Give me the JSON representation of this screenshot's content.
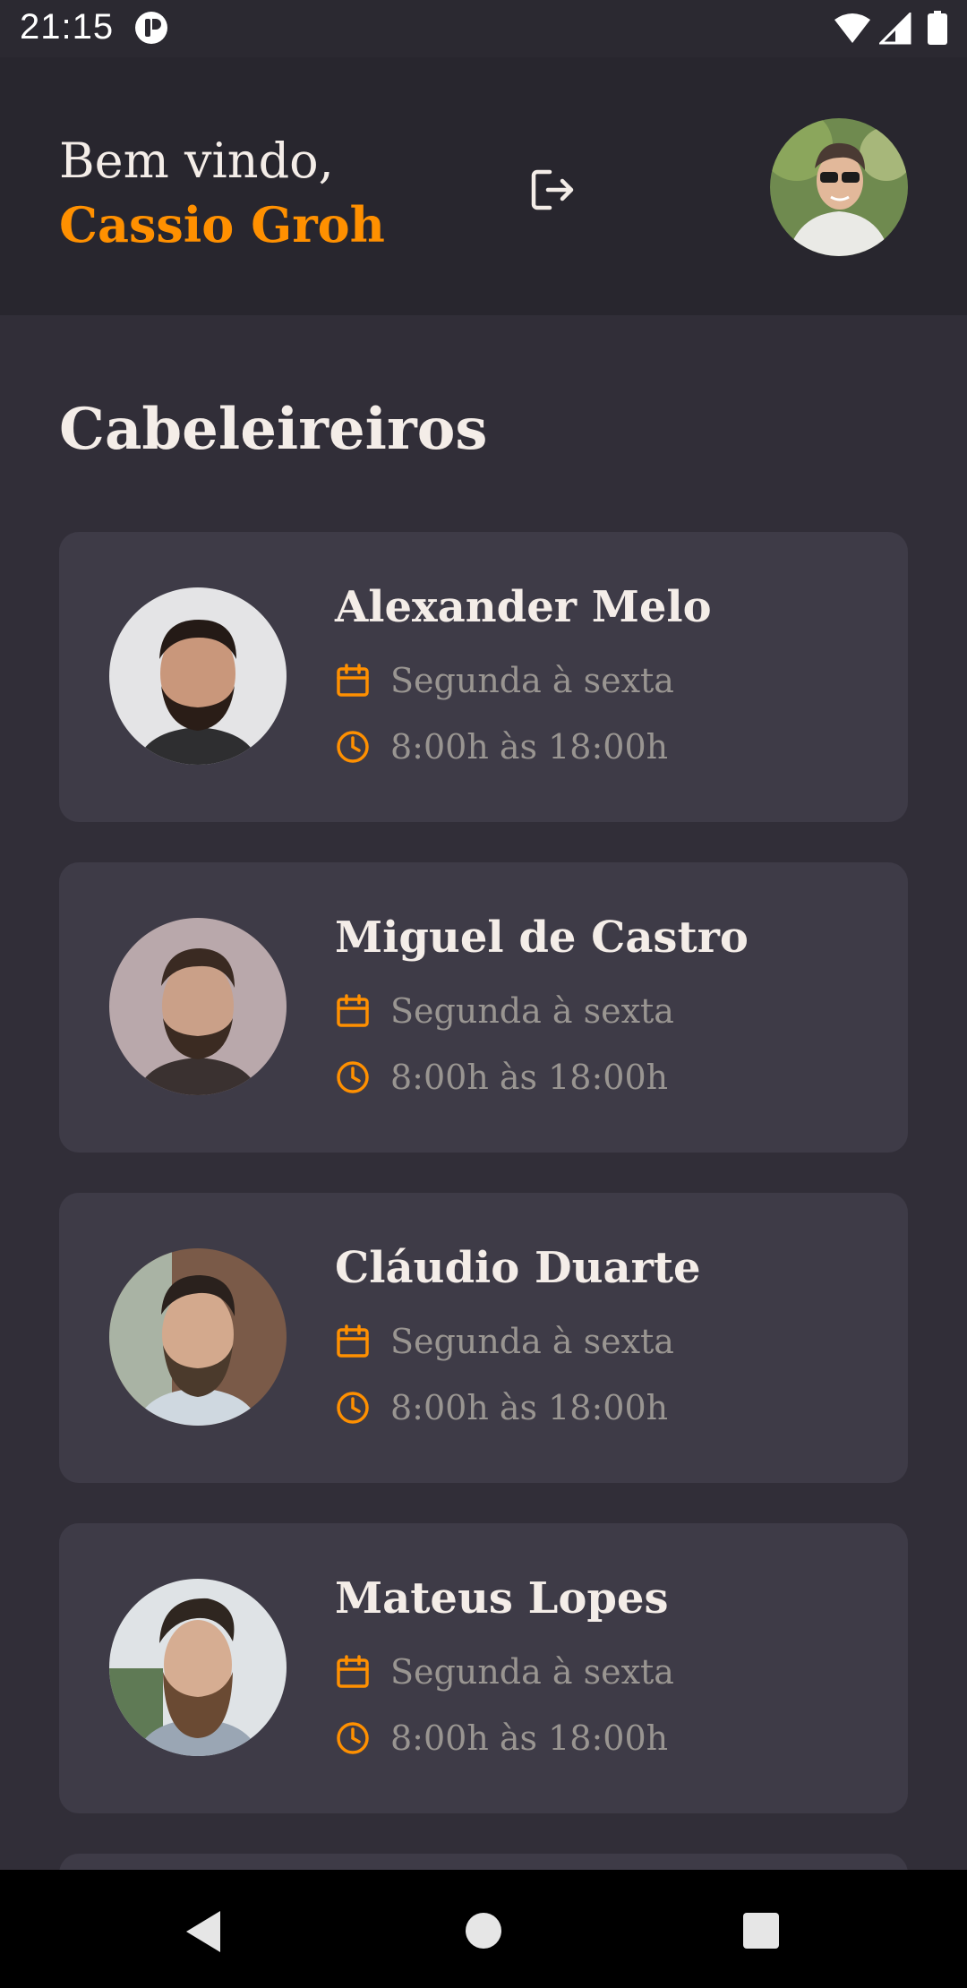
{
  "status_bar": {
    "time": "21:15"
  },
  "header": {
    "greeting": "Bem vindo,",
    "user_name": "Cassio Groh",
    "logout_icon": "logout-icon",
    "avatar_icon": "user-avatar"
  },
  "section": {
    "title": "Cabeleireiros"
  },
  "providers": [
    {
      "name": "Alexander Melo",
      "days": "Segunda à sexta",
      "hours": "8:00h às 18:00h"
    },
    {
      "name": "Miguel de Castro",
      "days": "Segunda à sexta",
      "hours": "8:00h às 18:00h"
    },
    {
      "name": "Cláudio Duarte",
      "days": "Segunda à sexta",
      "hours": "8:00h às 18:00h"
    },
    {
      "name": "Mateus Lopes",
      "days": "Segunda à sexta",
      "hours": "8:00h às 18:00h"
    }
  ],
  "colors": {
    "accent": "#ff9000",
    "background": "#312e38",
    "header_background": "#28262e",
    "card_background": "#3e3b47",
    "text": "#f4ede8",
    "muted_text": "#999591"
  },
  "icons": {
    "days": "calendar-icon",
    "hours": "clock-icon",
    "nav": [
      "back-icon",
      "home-icon",
      "recents-icon"
    ]
  }
}
